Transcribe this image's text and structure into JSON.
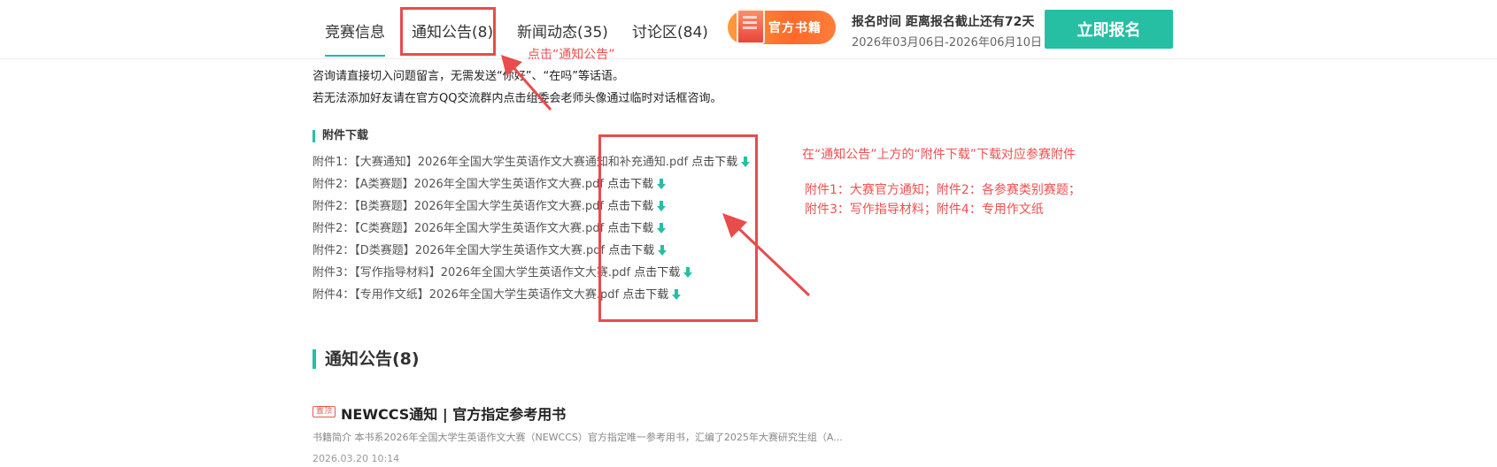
{
  "nav": {
    "tabs": [
      {
        "label": "竞赛信息",
        "count": ""
      },
      {
        "label": "通知公告",
        "count": "(8)"
      },
      {
        "label": "新闻动态",
        "count": "(35)"
      },
      {
        "label": "讨论区",
        "count": "(84)"
      }
    ],
    "book_badge_label": "官方书籍",
    "registration_title": "报名时间  距离报名截止还有72天",
    "registration_dates": "2026年03月06日-2026年06月10日",
    "register_button": "立即报名"
  },
  "intro": {
    "line1": "咨询请直接切入问题留言，无需发送“你好”、“在吗”等话语。",
    "line2": "若无法添加好友请在官方QQ交流群内点击组委会老师头像通过临时对话框咨询。"
  },
  "attachments": {
    "title": "附件下载",
    "download_label": "点击下载",
    "items": [
      {
        "label": "附件1：【大赛通知】2026年全国大学生英语作文大赛通知和补充通知.pdf"
      },
      {
        "label": "附件2：【A类赛题】2026年全国大学生英语作文大赛.pdf"
      },
      {
        "label": "附件2：【B类赛题】2026年全国大学生英语作文大赛.pdf"
      },
      {
        "label": "附件2：【C类赛题】2026年全国大学生英语作文大赛.pdf"
      },
      {
        "label": "附件2：【D类赛题】2026年全国大学生英语作文大赛.pdf"
      },
      {
        "label": "附件3：【写作指导材料】2026年全国大学生英语作文大赛.pdf"
      },
      {
        "label": "附件4：【专用作文纸】2026年全国大学生英语作文大赛.pdf"
      }
    ]
  },
  "notice_section": {
    "title": "通知公告(8)",
    "item": {
      "badge": "置顶",
      "title": "NEWCCS通知 | 官方指定参考用书",
      "summary": "书籍简介 本书系2026年全国大学生英语作文大赛（NEWCCS）官方指定唯一参考用书，汇编了2025年大赛研究生组（A...",
      "date": "2026.03.20 10:14"
    }
  },
  "annotations": {
    "click_notice": "点击“通知公告”",
    "download_hint": "在“通知公告”上方的“附件下载”下载对应参赛附件",
    "explain_line1": "附件1：大赛官方通知；附件2：各参赛类别赛题；",
    "explain_line2": "附件3：写作指导材料；附件4：专用作文纸",
    "color": "#e84c4c"
  },
  "colors": {
    "accent": "#26bfa4",
    "annotation": "#e84c4c",
    "book_badge": "#ff7a33"
  }
}
